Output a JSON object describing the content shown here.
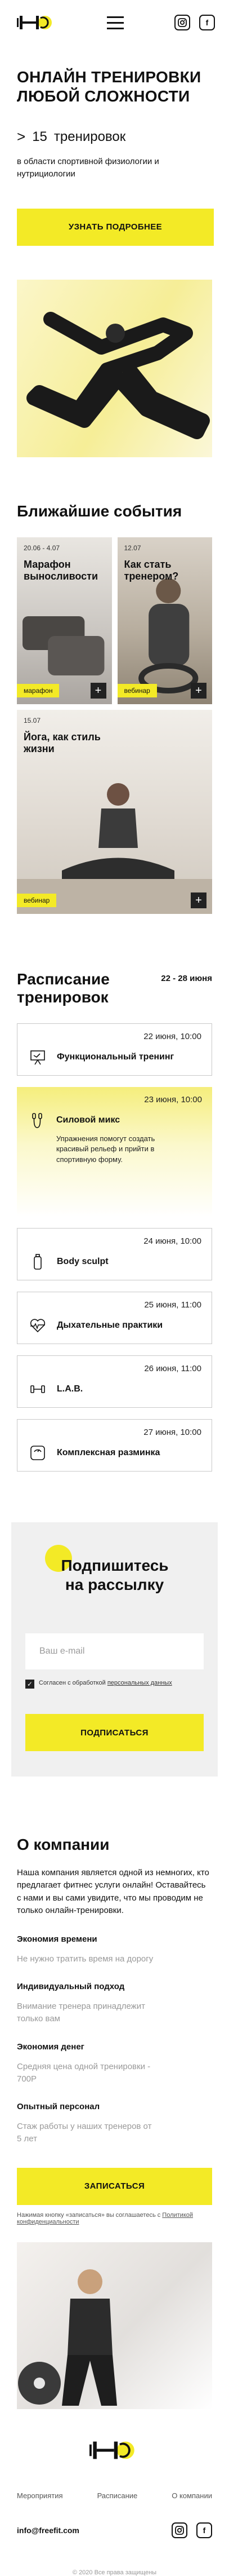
{
  "header": {
    "social": [
      {
        "label": "instagram-icon"
      },
      {
        "label": "vk-icon",
        "text": "f"
      }
    ]
  },
  "hero": {
    "title": "ОНЛАЙН ТРЕНИРОВКИ ЛЮБОЙ СЛОЖНОСТИ",
    "counter_prefix": ">",
    "counter_value": "15",
    "counter_label": "тренировок",
    "subtitle": "в области спортивной физиологии и нутрициологии",
    "cta": "УЗНАТЬ ПОДРОБНЕЕ"
  },
  "events": {
    "title": "Ближайшие события",
    "items": [
      {
        "date": "20.06 - 4.07",
        "title": "Марафон выносливости",
        "badge": "марафон"
      },
      {
        "date": "12.07",
        "title": "Как стать тренером?",
        "badge": "вебинар"
      },
      {
        "date": "15.07",
        "title": "Йога, как стиль жизни",
        "badge": "вебинар"
      }
    ]
  },
  "schedule": {
    "title": "Расписание тренировок",
    "range": "22 - 28 июня",
    "items": [
      {
        "date": "22 июня, 10:00",
        "name": "Функциональный тренинг",
        "icon": "whiteboard-icon"
      },
      {
        "date": "23 июня, 10:00",
        "name": "Силовой микс",
        "icon": "jump-rope-icon",
        "desc": "Упражнения помогут создать красивый рельеф и прийти в спортивную форму."
      },
      {
        "date": "24 июня, 10:00",
        "name": "Body sculpt",
        "icon": "bottle-icon"
      },
      {
        "date": "25 июня, 11:00",
        "name": "Дыхательные практики",
        "icon": "heartbeat-icon"
      },
      {
        "date": "26 июня, 11:00",
        "name": "L.A.B.",
        "icon": "dumbbell-icon"
      },
      {
        "date": "27 июня, 10:00",
        "name": "Комплексная разминка",
        "icon": "scale-icon"
      }
    ]
  },
  "subscribe": {
    "title": "Подпишитесь на рассылку",
    "placeholder": "Ваш e-mail",
    "agree_text": "Согласен с обработкой",
    "agree_link": "персональных данных",
    "button": "ПОДПИСАТЬСЯ"
  },
  "about": {
    "title": "О компании",
    "intro": "Наша компания является одной из немногих, кто предлагает фитнес услуги онлайн! Оставайтесь с нами и вы сами увидите, что мы проводим не только онлайн-тренировки.",
    "features": [
      {
        "title": "Экономия времени",
        "text": "Не нужно тратить время на дорогу"
      },
      {
        "title": "Индивидуальный подход",
        "text": "Внимание тренера принадлежит только вам"
      },
      {
        "title": "Экономия денег",
        "text": "Средняя цена одной тренировки - 700Р"
      },
      {
        "title": "Опытный персонал",
        "text": "Стаж работы у наших тренеров от 5 лет"
      }
    ],
    "button": "ЗАПИСАТЬСЯ",
    "note": "Нажимая кнопку «записаться» вы соглашаетесь с",
    "note_link": "Политикой конфиденциальности"
  },
  "footer": {
    "nav": [
      "Мероприятия",
      "Расписание",
      "О компании"
    ],
    "email": "info@freefit.com",
    "copyright": "© 2020 Все права защищены"
  }
}
